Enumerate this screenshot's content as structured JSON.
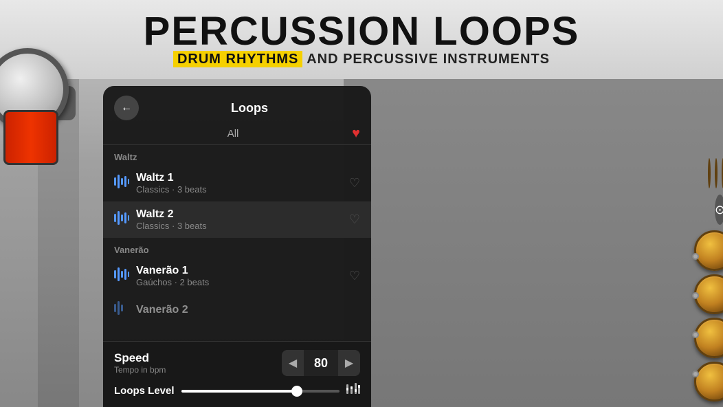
{
  "banner": {
    "title": "PERCUSSION LOOPS",
    "subtitle_highlight": "DRUM RHYTHMS",
    "subtitle_rest": " AND PERCUSSIVE INSTRUMENTS"
  },
  "panel": {
    "title": "Loops",
    "back_label": "←",
    "tab_all": "All",
    "heart_icon": "♥",
    "sections": [
      {
        "label": "Waltz",
        "items": [
          {
            "name": "Waltz 1",
            "desc": "Classics · 3 beats"
          },
          {
            "name": "Waltz 2",
            "desc": "Classics · 3 beats"
          }
        ]
      },
      {
        "label": "Vanerão",
        "items": [
          {
            "name": "Vanerão 1",
            "desc": "Gaúchos · 2 beats"
          },
          {
            "name": "Vanerão 2",
            "desc": ""
          }
        ]
      }
    ],
    "speed_label": "Speed",
    "speed_sublabel": "Tempo in bpm",
    "bpm_left": "◀",
    "bpm_value": "80",
    "bpm_right": "▶",
    "level_label": "Loops Level",
    "level_eq": "♩♩"
  },
  "toolbar_icons": [
    "≡",
    "▤",
    "✂",
    "♩♩",
    "🎧",
    "⚙"
  ],
  "colors": {
    "accent_blue": "#5599ff",
    "heart_red": "#e03030",
    "pad_gold": "#c08020",
    "bg_dark": "#191919"
  }
}
